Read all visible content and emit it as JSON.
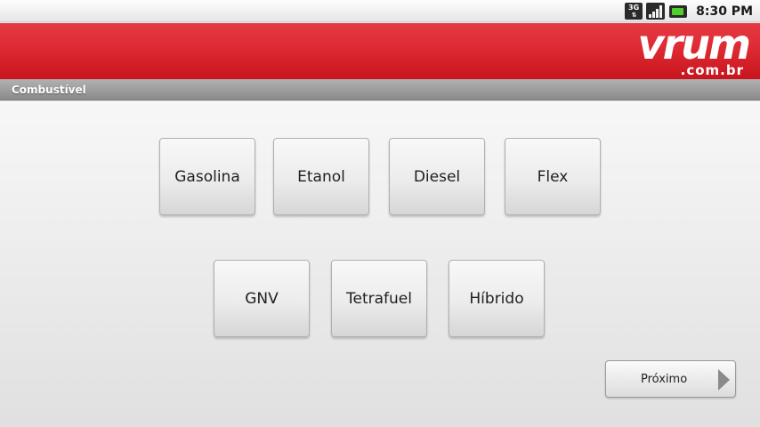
{
  "status_bar": {
    "network_label": "3G",
    "time": "8:30 PM"
  },
  "header": {
    "logo_main": "vrum",
    "logo_domain": ".com.br"
  },
  "title_bar": {
    "title": "Combustível"
  },
  "fuel_options": [
    "Gasolina",
    "Etanol",
    "Diesel",
    "Flex",
    "GNV",
    "Tetrafuel",
    "Híbrido"
  ],
  "next_button": {
    "label": "Próximo"
  },
  "colors": {
    "header_red": "#dd2a33",
    "battery_green": "#4fd12a"
  },
  "icons": [
    "3g-icon",
    "signal-icon",
    "battery-icon",
    "chevron-right-icon"
  ]
}
